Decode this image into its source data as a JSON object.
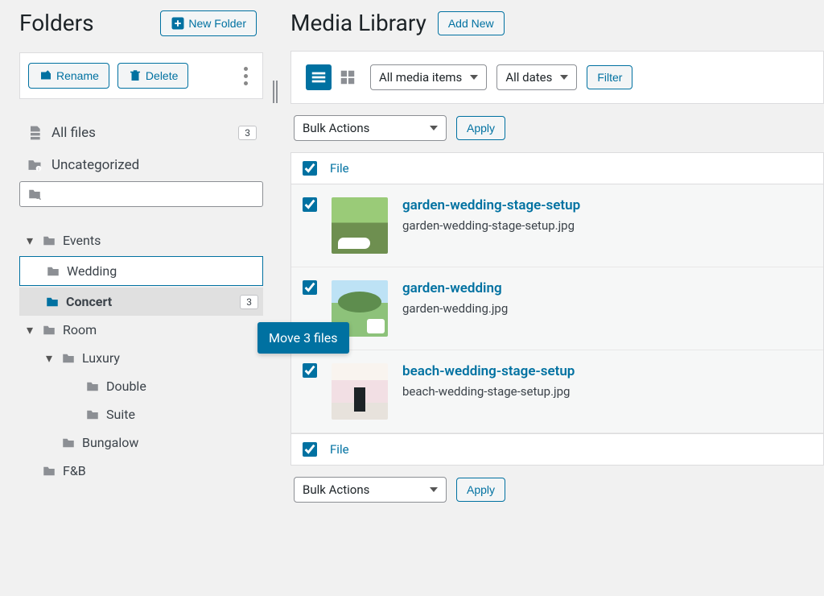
{
  "sidebar": {
    "title": "Folders",
    "new_folder_label": "New Folder",
    "rename_label": "Rename",
    "delete_label": "Delete",
    "all_files_label": "All files",
    "all_files_count": "3",
    "uncategorized_label": "Uncategorized",
    "search_placeholder": ""
  },
  "tree": {
    "events": "Events",
    "wedding": "Wedding",
    "concert": "Concert",
    "concert_count": "3",
    "room": "Room",
    "luxury": "Luxury",
    "double": "Double",
    "suite": "Suite",
    "bungalow": "Bungalow",
    "fnb": "F&B"
  },
  "drag": {
    "label": "Move 3 files"
  },
  "main": {
    "title": "Media Library",
    "add_new_label": "Add New",
    "type_filter": "All media items",
    "date_filter": "All dates",
    "filter_label": "Filter",
    "bulk_label": "Bulk Actions",
    "apply_label": "Apply",
    "file_col": "File"
  },
  "rows": [
    {
      "title": "garden-wedding-stage-setup",
      "filename": "garden-wedding-stage-setup.jpg"
    },
    {
      "title": "garden-wedding",
      "filename": "garden-wedding.jpg"
    },
    {
      "title": "beach-wedding-stage-setup",
      "filename": "beach-wedding-stage-setup.jpg"
    }
  ]
}
